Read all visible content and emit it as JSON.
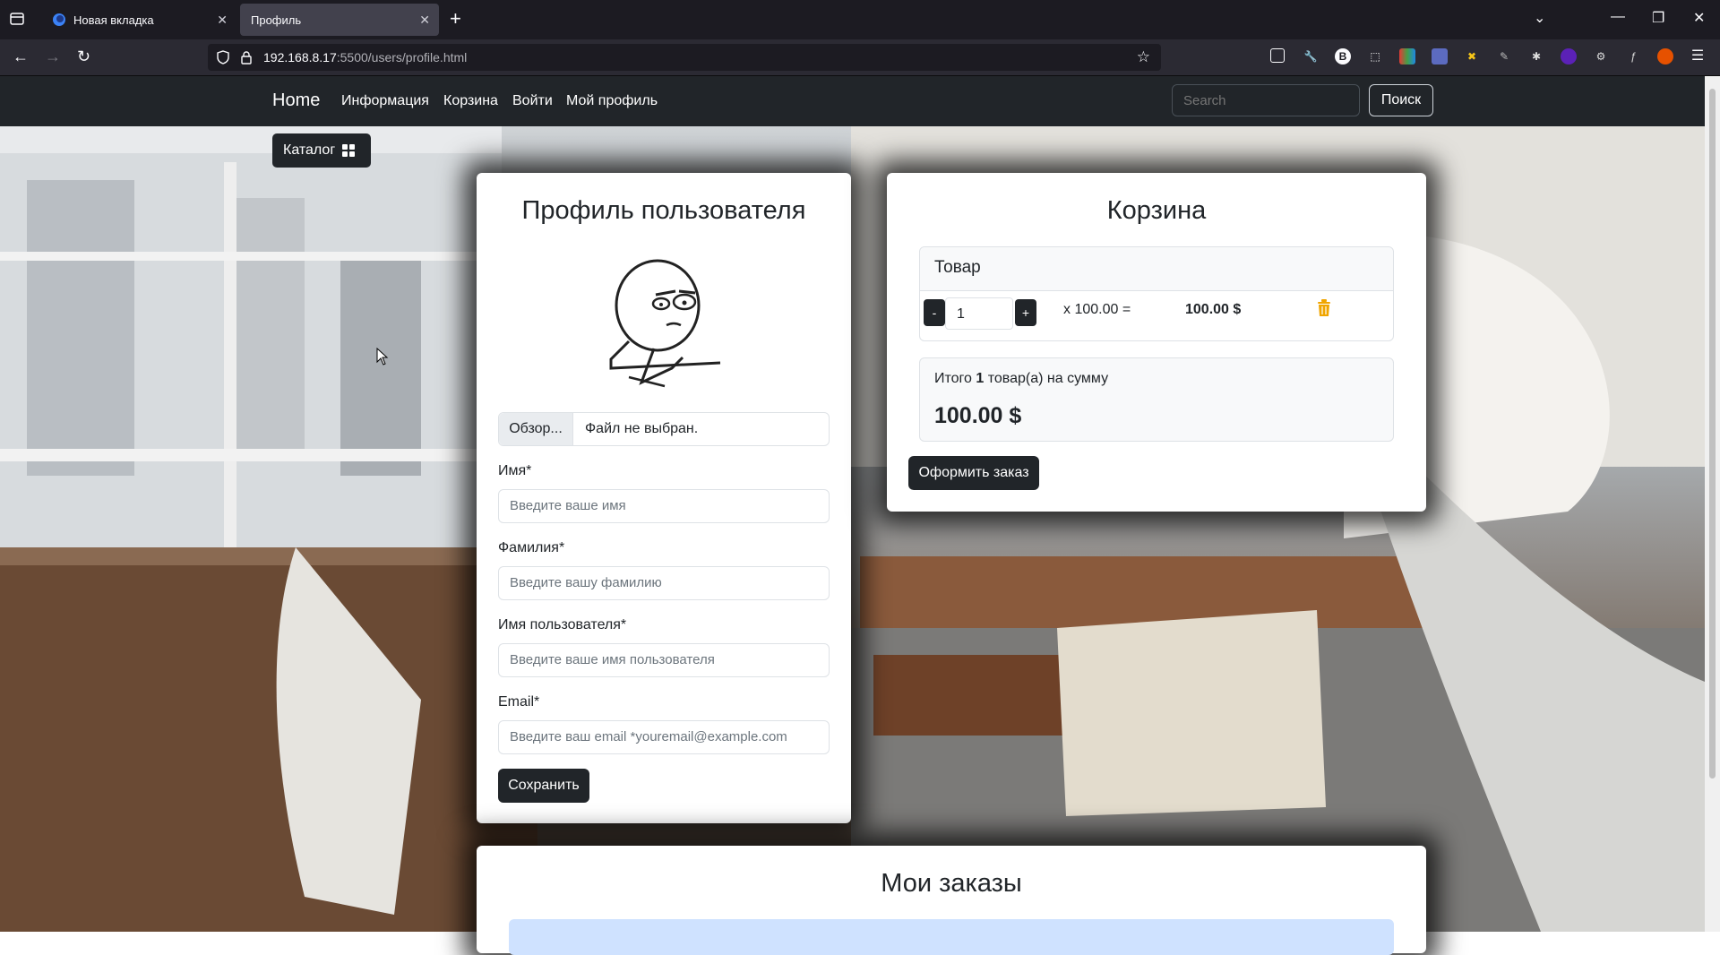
{
  "browser": {
    "tabs": [
      {
        "title": "Новая вкладка",
        "active": false
      },
      {
        "title": "Профиль",
        "active": true
      }
    ],
    "url_host": "192.168.8.17",
    "url_rest": ":5500/users/profile.html"
  },
  "navbar": {
    "brand": "Home",
    "links": [
      "Информация",
      "Корзина",
      "Войти",
      "Мой профиль"
    ],
    "search_placeholder": "Search",
    "search_button": "Поиск"
  },
  "catalog_label": "Каталог",
  "profile": {
    "title": "Профиль пользователя",
    "file_browse": "Обзор...",
    "file_status": "Файл не выбран.",
    "fields": [
      {
        "label": "Имя*",
        "placeholder": "Введите ваше имя"
      },
      {
        "label": "Фамилия*",
        "placeholder": "Введите вашу фамилию"
      },
      {
        "label": "Имя пользователя*",
        "placeholder": "Введите ваше имя пользователя"
      },
      {
        "label": "Email*",
        "placeholder": "Введите ваш email *youremail@example.com"
      }
    ],
    "save_button": "Сохранить"
  },
  "cart": {
    "title": "Корзина",
    "header": "Товар",
    "minus": "-",
    "plus": "+",
    "quantity": "1",
    "times_price": "x 100.00 =",
    "line_total": "100.00 $",
    "total_prefix": "Итого ",
    "total_count": "1",
    "total_suffix": " товар(а) на сумму",
    "total_sum": "100.00 $",
    "order_button": "Оформить заказ"
  },
  "orders": {
    "title": "Мои заказы"
  },
  "colors": {
    "navbar_bg": "#212529",
    "button_dark": "#212529",
    "trash_icon": "#f0a500",
    "orders_alert": "#cfe2ff"
  }
}
